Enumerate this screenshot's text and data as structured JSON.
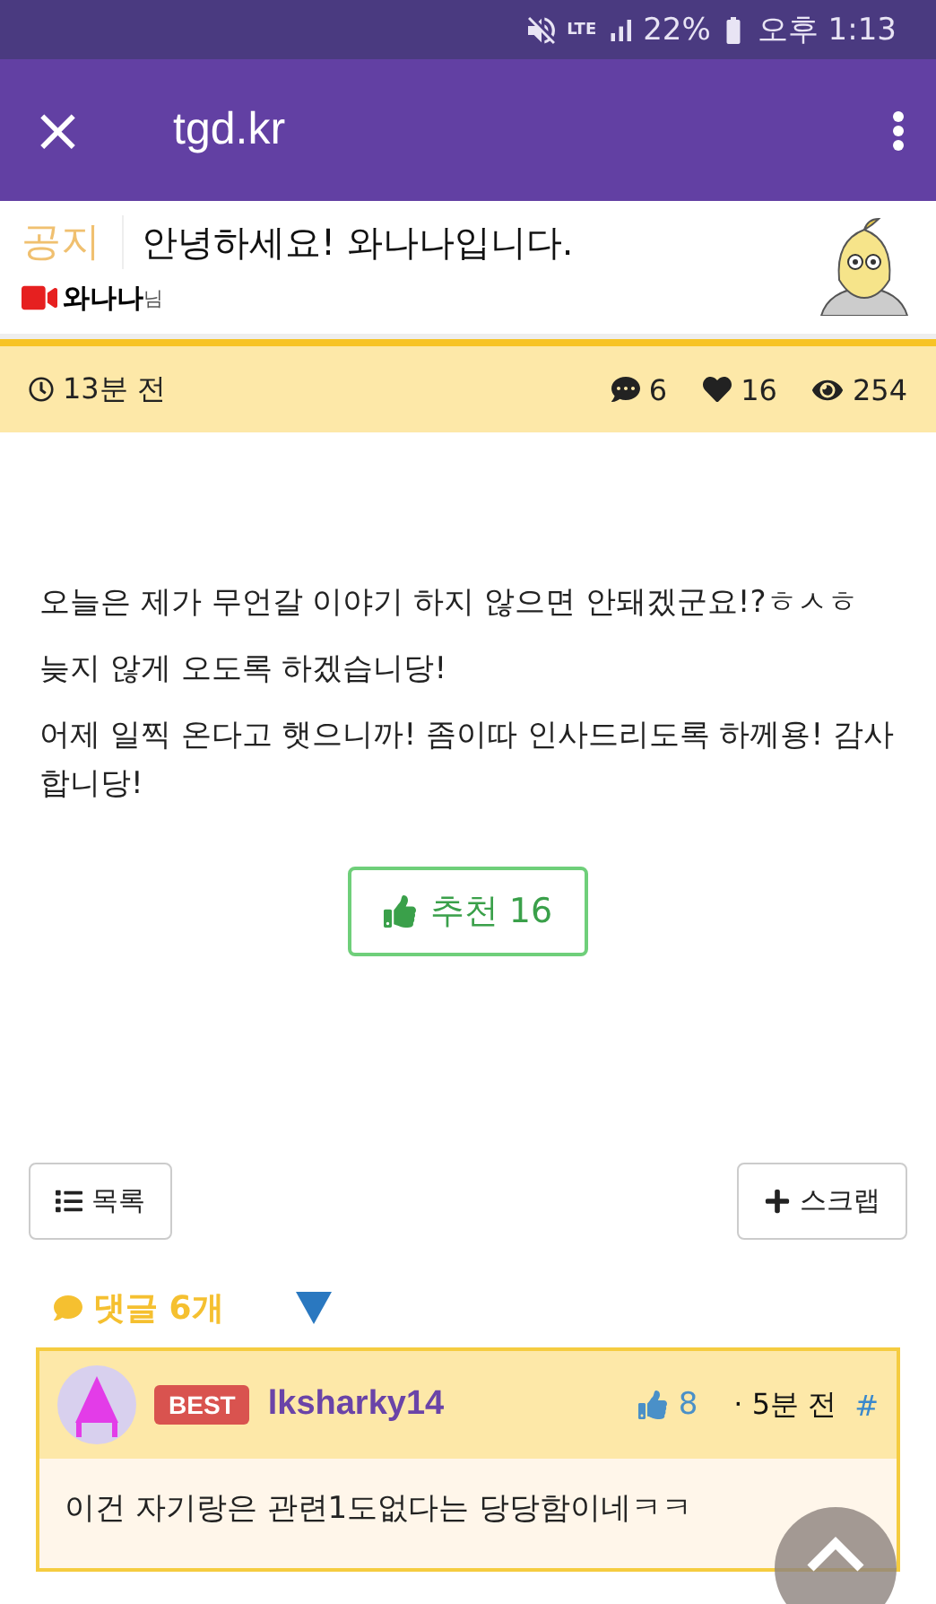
{
  "status_bar": {
    "network": "LTE",
    "battery": "22%",
    "time": "오후 1:13"
  },
  "app_bar": {
    "close": "×",
    "title": "tgd.kr"
  },
  "post": {
    "category": "공지",
    "title": "안녕하세요! 와나나입니다.",
    "author": "와나나",
    "author_suffix": "님",
    "time": "13분 전",
    "comments": "6",
    "likes": "16",
    "views": "254",
    "paragraphs": [
      "오늘은 제가 무언갈 이야기 하지 않으면 안돼겠군요!?ㅎㅅㅎ",
      "늦지 않게 오도록 하겠습니당!",
      "어제 일찍 온다고 햇으니까! 좀이따 인사드리도록 하께용! 감사합니당!"
    ],
    "recommend": {
      "label": "추천",
      "count": "16"
    }
  },
  "actions": [
    {
      "kind": "list",
      "label": "목록"
    },
    {
      "kind": "scrap",
      "label": "스크랩"
    }
  ],
  "comments_header": {
    "label": "댓글 6개",
    "expanded": true
  },
  "comments": [
    {
      "best": true,
      "badge": "BEST",
      "user": "lksharky14",
      "likes": "8",
      "time": "· 5분 전",
      "anchor": "#",
      "text": "이건 자기랑은 관련1도없다는 당당함이네ㅋㅋ"
    }
  ]
}
